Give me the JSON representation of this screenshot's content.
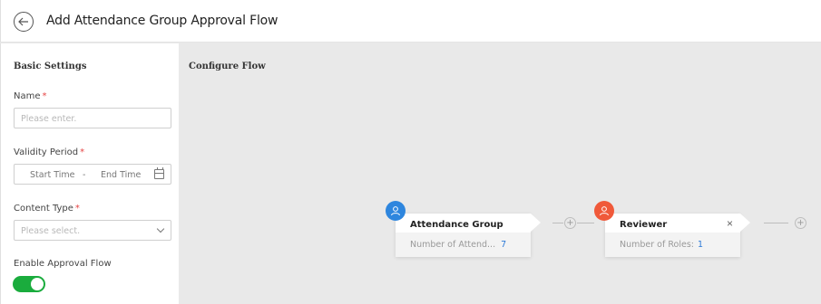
{
  "header": {
    "title": "Add Attendance Group Approval Flow"
  },
  "basic_settings": {
    "title": "Basic Settings",
    "name_label": "Name",
    "name_placeholder": "Please enter.",
    "validity_label": "Validity Period",
    "start_time": "Start Time",
    "range_sep": "-",
    "end_time": "End Time",
    "content_type_label": "Content Type",
    "content_type_placeholder": "Please select.",
    "enable_flow_label": "Enable Approval Flow",
    "enable_flow_on": true,
    "required_mark": "*"
  },
  "configure_flow": {
    "title": "Configure Flow",
    "nodes": [
      {
        "title": "Attendance Group",
        "sub_label": "Number of Attend...",
        "count": "7",
        "avatar_color": "#2e86de"
      },
      {
        "title": "Reviewer",
        "sub_label": "Number of Roles:",
        "count": "1",
        "avatar_color": "#f0593a"
      }
    ],
    "plus_symbol": "+",
    "close_symbol": "×"
  },
  "colors": {
    "accent": "#1aac3d",
    "link": "#2e7bd8",
    "required": "#e64545"
  }
}
